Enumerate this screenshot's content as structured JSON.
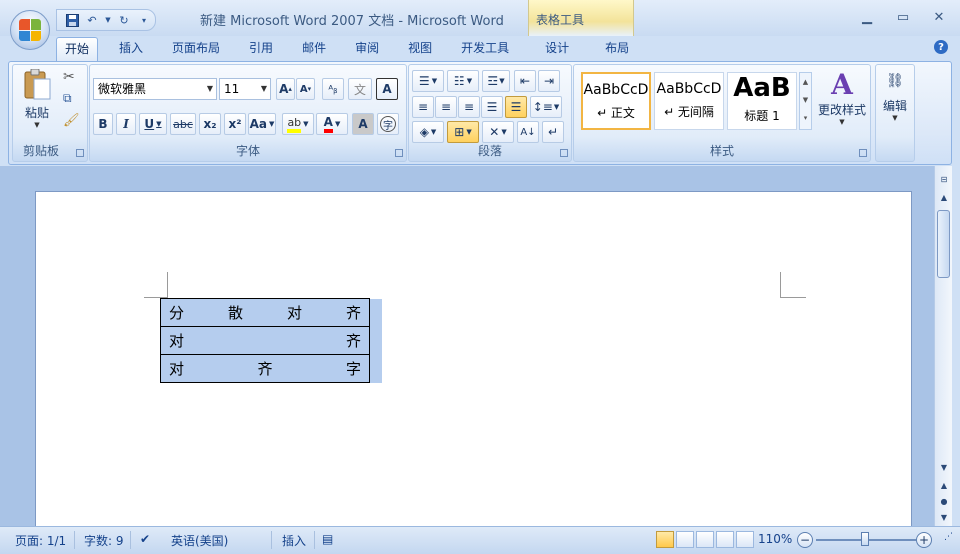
{
  "window": {
    "title": "新建 Microsoft Word 2007 文档 - Microsoft Word",
    "context_tab": "表格工具",
    "controls": [
      "minimize",
      "maximize",
      "close"
    ]
  },
  "tabs": [
    {
      "label": "开始",
      "active": true
    },
    {
      "label": "插入"
    },
    {
      "label": "页面布局"
    },
    {
      "label": "引用"
    },
    {
      "label": "邮件"
    },
    {
      "label": "审阅"
    },
    {
      "label": "视图"
    },
    {
      "label": "开发工具"
    },
    {
      "label": "设计"
    },
    {
      "label": "布局"
    }
  ],
  "ribbon": {
    "clipboard": {
      "label": "剪贴板",
      "paste_label": "粘贴"
    },
    "font": {
      "label": "字体",
      "font_name": "微软雅黑",
      "font_size": "11",
      "buttons": {
        "bold": "B",
        "italic": "I",
        "underline": "U",
        "strike": "abc",
        "sub": "x₂",
        "sup": "x²",
        "case": "Aa",
        "color": "A",
        "grow": "A",
        "shrink": "A",
        "char_border": "A"
      }
    },
    "paragraph": {
      "label": "段落"
    },
    "styles": {
      "label": "样式",
      "items": [
        {
          "sample": "AaBbCcD",
          "name": "↵ 正文"
        },
        {
          "sample": "AaBbCcD",
          "name": "↵ 无间隔"
        },
        {
          "sample": "AaB",
          "name": "标题 1"
        }
      ],
      "change_label": "更改样式"
    },
    "editing": {
      "label": "编辑"
    }
  },
  "document": {
    "table": [
      [
        "分",
        "散",
        "对",
        "齐"
      ],
      [
        "对",
        "齐"
      ],
      [
        "对",
        "齐",
        "字"
      ]
    ]
  },
  "status": {
    "page": "页面: 1/1",
    "words": "字数: 9",
    "language": "英语(美国)",
    "mode": "插入",
    "zoom": "110%"
  },
  "colors": {
    "ribbon_border": "#8db2e3",
    "table_fill": "#b5cdee",
    "accent": "#15428b"
  }
}
